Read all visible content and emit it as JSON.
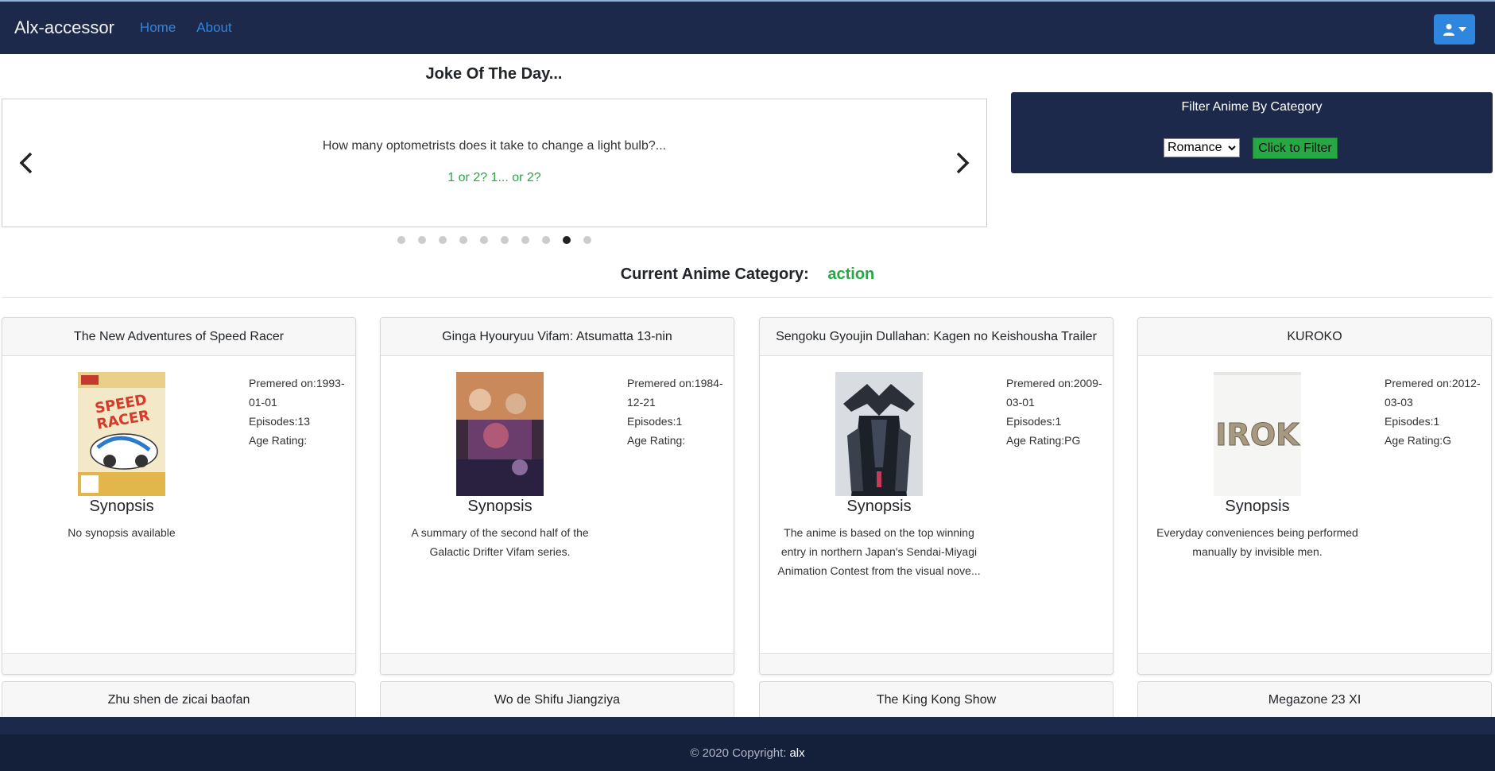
{
  "navbar": {
    "brand": "Alx-accessor",
    "links": [
      "Home",
      "About"
    ],
    "user_icon": "user-icon"
  },
  "joke": {
    "heading": "Joke Of The Day...",
    "question": "How many optometrists does it take to change a light bulb?...",
    "answer": "1 or 2? 1... or 2?",
    "slide_count": 10,
    "active_slide": 9
  },
  "filter": {
    "title": "Filter Anime By Category",
    "selected": "Romance",
    "button": "Click to Filter"
  },
  "category": {
    "label": "Current Anime Category:",
    "value": "action"
  },
  "cards": [
    {
      "title": "The New Adventures of Speed Racer",
      "premiered": "Premered on:1993-01-01",
      "episodes": "Episodes:13",
      "age": "Age Rating:",
      "synopsis_title": "Synopsis",
      "synopsis": "No synopsis available"
    },
    {
      "title": "Ginga Hyouryuu Vifam: Atsumatta 13-nin",
      "premiered": "Premered on:1984-12-21",
      "episodes": "Episodes:1",
      "age": "Age Rating:",
      "synopsis_title": "Synopsis",
      "synopsis": "A summary of the second half of the Galactic Drifter Vifam series."
    },
    {
      "title": "Sengoku Gyoujin Dullahan: Kagen no Keishousha Trailer",
      "premiered": "Premered on:2009-03-01",
      "episodes": "Episodes:1",
      "age": "Age Rating:PG",
      "synopsis_title": "Synopsis",
      "synopsis": "The anime is based on the top winning entry in northern Japan's Sendai-Miyagi Animation Contest from the visual nove..."
    },
    {
      "title": "KUROKO",
      "premiered": "Premered on:2012-03-03",
      "episodes": "Episodes:1",
      "age": "Age Rating:G",
      "synopsis_title": "Synopsis",
      "synopsis": "Everyday conveniences being performed manually by invisible men."
    }
  ],
  "cards_row2": [
    "Zhu shen de zicai baofan",
    "Wo de Shifu Jiangziya",
    "The King Kong Show",
    "Megazone 23 XI"
  ],
  "footer": {
    "text": "© 2020 Copyright:",
    "owner": "alx"
  },
  "colors": {
    "navbar": "#1c294a",
    "accent": "#2e86de",
    "green": "#28a745"
  }
}
